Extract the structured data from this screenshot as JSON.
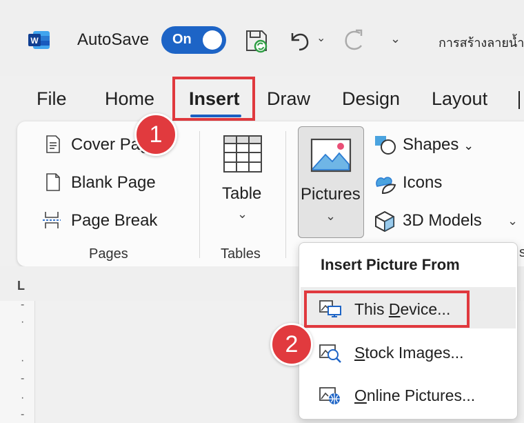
{
  "titlebar": {
    "autosave_label": "AutoSave",
    "toggle_state": "On",
    "undo_dropdown": "⌄",
    "qat_dropdown": "⌄",
    "document_title": "การสร้างลายน้ำ"
  },
  "tabs": [
    {
      "label": "File"
    },
    {
      "label": "Home"
    },
    {
      "label": "Insert",
      "active": true
    },
    {
      "label": "Draw"
    },
    {
      "label": "Design"
    },
    {
      "label": "Layout"
    }
  ],
  "ribbon": {
    "pages_group": {
      "label": "Pages",
      "items": [
        {
          "label": "Cover Page"
        },
        {
          "label": "Blank Page"
        },
        {
          "label": "Page Break"
        }
      ]
    },
    "tables_group": {
      "label": "Tables",
      "table_label": "Table",
      "dropdown": "⌄"
    },
    "illustrations": {
      "pictures_label": "Pictures",
      "pictures_dropdown": "⌄",
      "shapes_label": "Shapes",
      "shapes_dropdown": "⌄",
      "icons_label": "Icons",
      "models_label": "3D Models",
      "models_dropdown": "⌄",
      "group_label_cut": "s"
    }
  },
  "ruler": {
    "corner": "L",
    "marks": [
      "-",
      "·",
      "·",
      "-",
      "·",
      "-"
    ]
  },
  "insert_picture_menu": {
    "header": "Insert Picture From",
    "items": [
      {
        "label": "This Device...",
        "access_key": "D",
        "before": "This ",
        "after": "evice..."
      },
      {
        "label": "Stock Images...",
        "access_key": "S",
        "before": "",
        "after": "tock Images..."
      },
      {
        "label": "Online Pictures...",
        "access_key": "O",
        "before": "",
        "after": "nline Pictures..."
      }
    ]
  },
  "annotations": {
    "step1": "1",
    "step2": "2",
    "highlight_color": "#e0393e"
  },
  "colors": {
    "accent": "#1b5ec2",
    "toggle_on": "#1d64c6",
    "word_blue": "#185abd"
  }
}
